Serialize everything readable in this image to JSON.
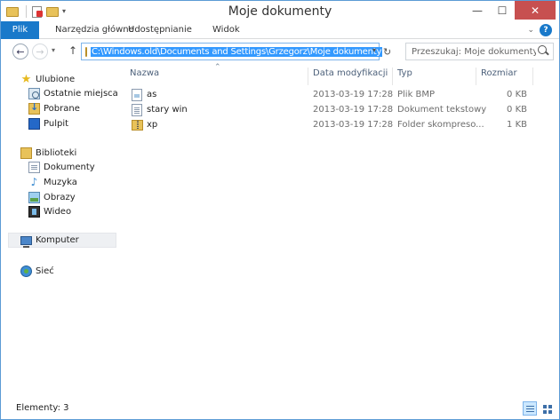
{
  "window": {
    "title": "Moje dokumenty"
  },
  "quick_access": {
    "icons": [
      "folder-icon",
      "properties-icon",
      "new-folder-icon",
      "dropdown-arrow-icon"
    ]
  },
  "ribbon": {
    "tabs": [
      {
        "label": "Plik",
        "active": true
      },
      {
        "label": "Narzędzia główne"
      },
      {
        "label": "Udostępnianie"
      },
      {
        "label": "Widok"
      }
    ]
  },
  "address_bar": {
    "path": "C:\\Windows.old\\Documents and Settings\\Grzegorz\\Moje dokumenty"
  },
  "search": {
    "placeholder": "Przeszukaj: Moje dokumenty"
  },
  "navigation": {
    "favorites": {
      "label": "Ulubione",
      "items": [
        {
          "label": "Ostatnie miejsca",
          "icon": "recent-places-icon"
        },
        {
          "label": "Pobrane",
          "icon": "downloads-icon"
        },
        {
          "label": "Pulpit",
          "icon": "desktop-icon"
        }
      ]
    },
    "libraries": {
      "label": "Biblioteki",
      "items": [
        {
          "label": "Dokumenty",
          "icon": "documents-icon"
        },
        {
          "label": "Muzyka",
          "icon": "music-icon"
        },
        {
          "label": "Obrazy",
          "icon": "pictures-icon"
        },
        {
          "label": "Wideo",
          "icon": "video-icon"
        }
      ]
    },
    "computer": {
      "label": "Komputer"
    },
    "network": {
      "label": "Sieć"
    }
  },
  "file_list": {
    "columns": [
      "Nazwa",
      "Data modyfikacji",
      "Typ",
      "Rozmiar"
    ],
    "rows": [
      {
        "name": "as",
        "modified": "2013-03-19 17:28",
        "type": "Plik BMP",
        "size": "0 KB",
        "icon": "bmp-file-icon"
      },
      {
        "name": "stary win",
        "modified": "2013-03-19 17:28",
        "type": "Dokument tekstowy",
        "size": "0 KB",
        "icon": "text-file-icon"
      },
      {
        "name": "xp",
        "modified": "2013-03-19 17:28",
        "type": "Folder skompreso...",
        "size": "1 KB",
        "icon": "zip-folder-icon"
      }
    ]
  },
  "status_bar": {
    "item_count": "Elementy: 3"
  },
  "colors": {
    "accent": "#1979ca",
    "selection": "#3399ff"
  }
}
